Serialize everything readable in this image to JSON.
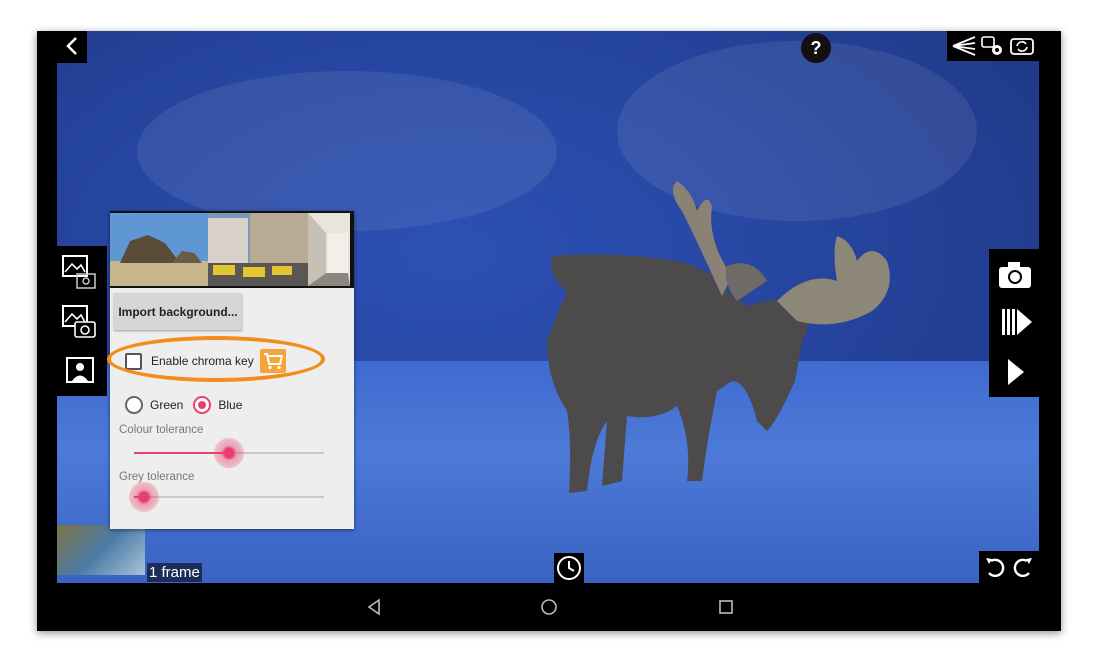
{
  "top_bar": {
    "back_icon": "chevron-left-icon",
    "help_label": "?",
    "right_icons": [
      "frame-guide-icon",
      "settings-icon",
      "switch-camera-icon"
    ]
  },
  "left_toolbar": {
    "icons": [
      "background-image-icon",
      "image-camera-icon",
      "person-portrait-icon"
    ]
  },
  "right_toolbar": {
    "icons": [
      "camera-icon",
      "play-frames-icon",
      "play-icon"
    ]
  },
  "chroma_panel": {
    "import_button_label": "Import background...",
    "enable_chroma_key_label": "Enable chroma key",
    "enable_chroma_key_checked": false,
    "cart_icon": "shopping-cart-icon",
    "highlight_color": "#f28c1c",
    "radio_options": [
      {
        "label": "Green",
        "selected": false
      },
      {
        "label": "Blue",
        "selected": true
      }
    ],
    "colour_tolerance_label": "Colour tolerance",
    "colour_tolerance_value": 0.5,
    "grey_tolerance_label": "Grey tolerance",
    "grey_tolerance_value": 0.05,
    "accent_color": "#e8406e"
  },
  "bottom": {
    "frame_count_label": "1 frame",
    "timer_icon": "clock-icon",
    "undo_icon": "undo-icon",
    "redo_icon": "redo-icon"
  },
  "nav_bar": {
    "icons": [
      "back-triangle-icon",
      "home-circle-icon",
      "recents-square-icon"
    ]
  }
}
